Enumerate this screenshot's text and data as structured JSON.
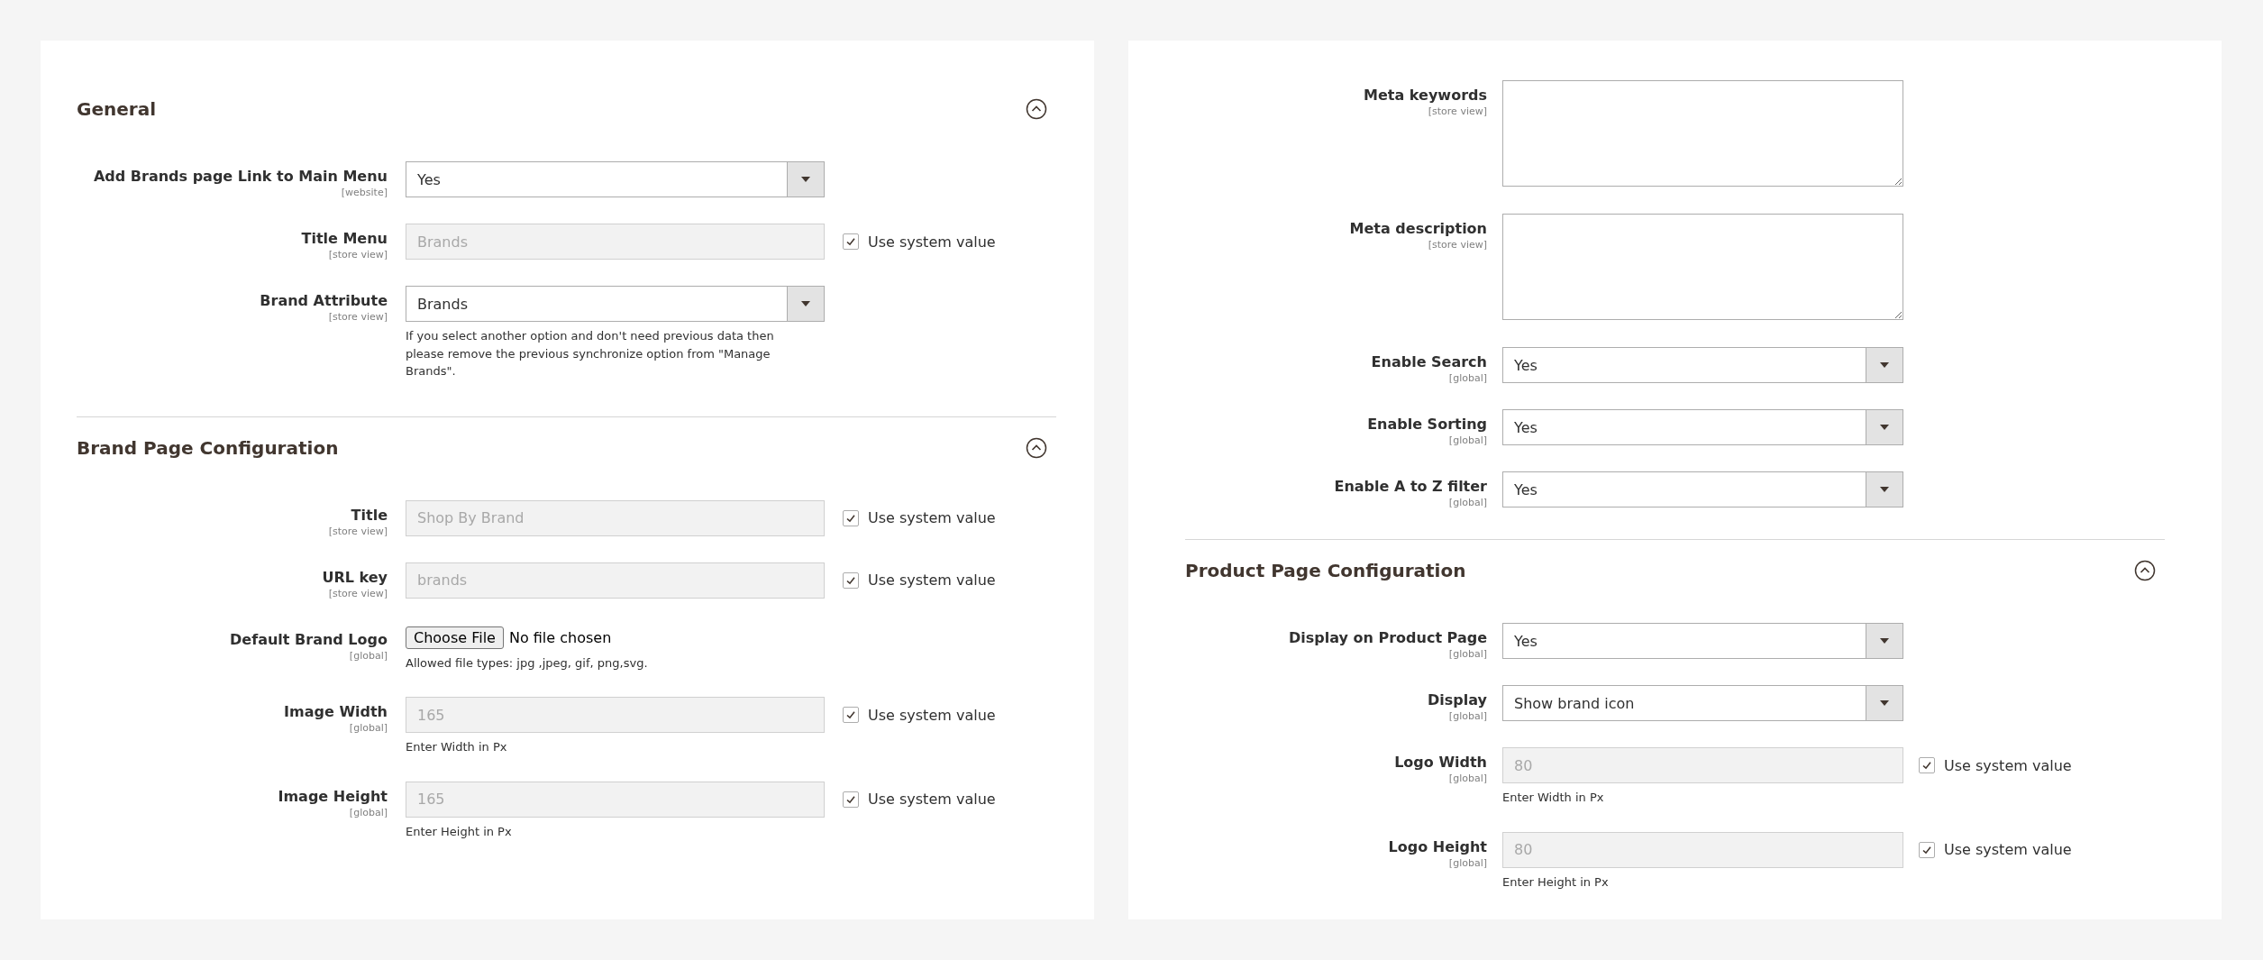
{
  "panels": [
    {
      "sections": [
        {
          "title": "General",
          "expanded": true,
          "divider_before": false,
          "fields": [
            {
              "kind": "select",
              "label": "Add Brands page Link to Main Menu",
              "scope": "[website]",
              "value": "Yes"
            },
            {
              "kind": "text",
              "label": "Title Menu",
              "scope": "[store view]",
              "value": "Brands",
              "disabled": true,
              "use_system": {
                "label": "Use system value",
                "checked": true
              }
            },
            {
              "kind": "select",
              "label": "Brand Attribute",
              "scope": "[store view]",
              "value": "Brands",
              "note": "If you select another option and don't need previous data then please remove the previous synchronize option from \"Manage Brands\"."
            }
          ]
        },
        {
          "title": "Brand Page Configuration",
          "expanded": true,
          "divider_before": true,
          "fields": [
            {
              "kind": "text",
              "label": "Title",
              "scope": "[store view]",
              "value": "Shop By Brand",
              "disabled": true,
              "use_system": {
                "label": "Use system value",
                "checked": true
              }
            },
            {
              "kind": "text",
              "label": "URL key",
              "scope": "[store view]",
              "value": "brands",
              "disabled": true,
              "use_system": {
                "label": "Use system value",
                "checked": true
              }
            },
            {
              "kind": "file",
              "label": "Default Brand Logo",
              "scope": "[global]",
              "button": "Choose File",
              "value": "No file chosen",
              "note": "Allowed file types: jpg ,jpeg, gif, png,svg."
            },
            {
              "kind": "text",
              "label": "Image Width",
              "scope": "[global]",
              "value": "165",
              "disabled": true,
              "use_system": {
                "label": "Use system value",
                "checked": true
              },
              "note": "Enter Width in Px"
            },
            {
              "kind": "text",
              "label": "Image Height",
              "scope": "[global]",
              "value": "165",
              "disabled": true,
              "use_system": {
                "label": "Use system value",
                "checked": true
              },
              "note": "Enter Height in Px"
            }
          ]
        }
      ]
    },
    {
      "sections": [
        {
          "divider_before": false,
          "fields": [
            {
              "kind": "textarea",
              "label": "Meta keywords",
              "scope": "[store view]"
            },
            {
              "kind": "textarea",
              "label": "Meta description",
              "scope": "[store view]"
            },
            {
              "kind": "select",
              "label": "Enable Search",
              "scope": "[global]",
              "value": "Yes"
            },
            {
              "kind": "select",
              "label": "Enable Sorting",
              "scope": "[global]",
              "value": "Yes"
            },
            {
              "kind": "select",
              "label": "Enable A to Z filter",
              "scope": "[global]",
              "value": "Yes"
            }
          ]
        },
        {
          "title": "Product Page Configuration",
          "expanded": true,
          "divider_before": true,
          "fields": [
            {
              "kind": "select",
              "label": "Display on Product Page",
              "scope": "[global]",
              "value": "Yes"
            },
            {
              "kind": "select",
              "label": "Display",
              "scope": "[global]",
              "value": "Show brand icon"
            },
            {
              "kind": "text",
              "label": "Logo Width",
              "scope": "[global]",
              "value": "80",
              "disabled": true,
              "use_system": {
                "label": "Use system value",
                "checked": true
              },
              "note": "Enter Width in Px"
            },
            {
              "kind": "text",
              "label": "Logo Height",
              "scope": "[global]",
              "value": "80",
              "disabled": true,
              "use_system": {
                "label": "Use system value",
                "checked": true
              },
              "note": "Enter Height in Px"
            }
          ]
        }
      ]
    }
  ]
}
